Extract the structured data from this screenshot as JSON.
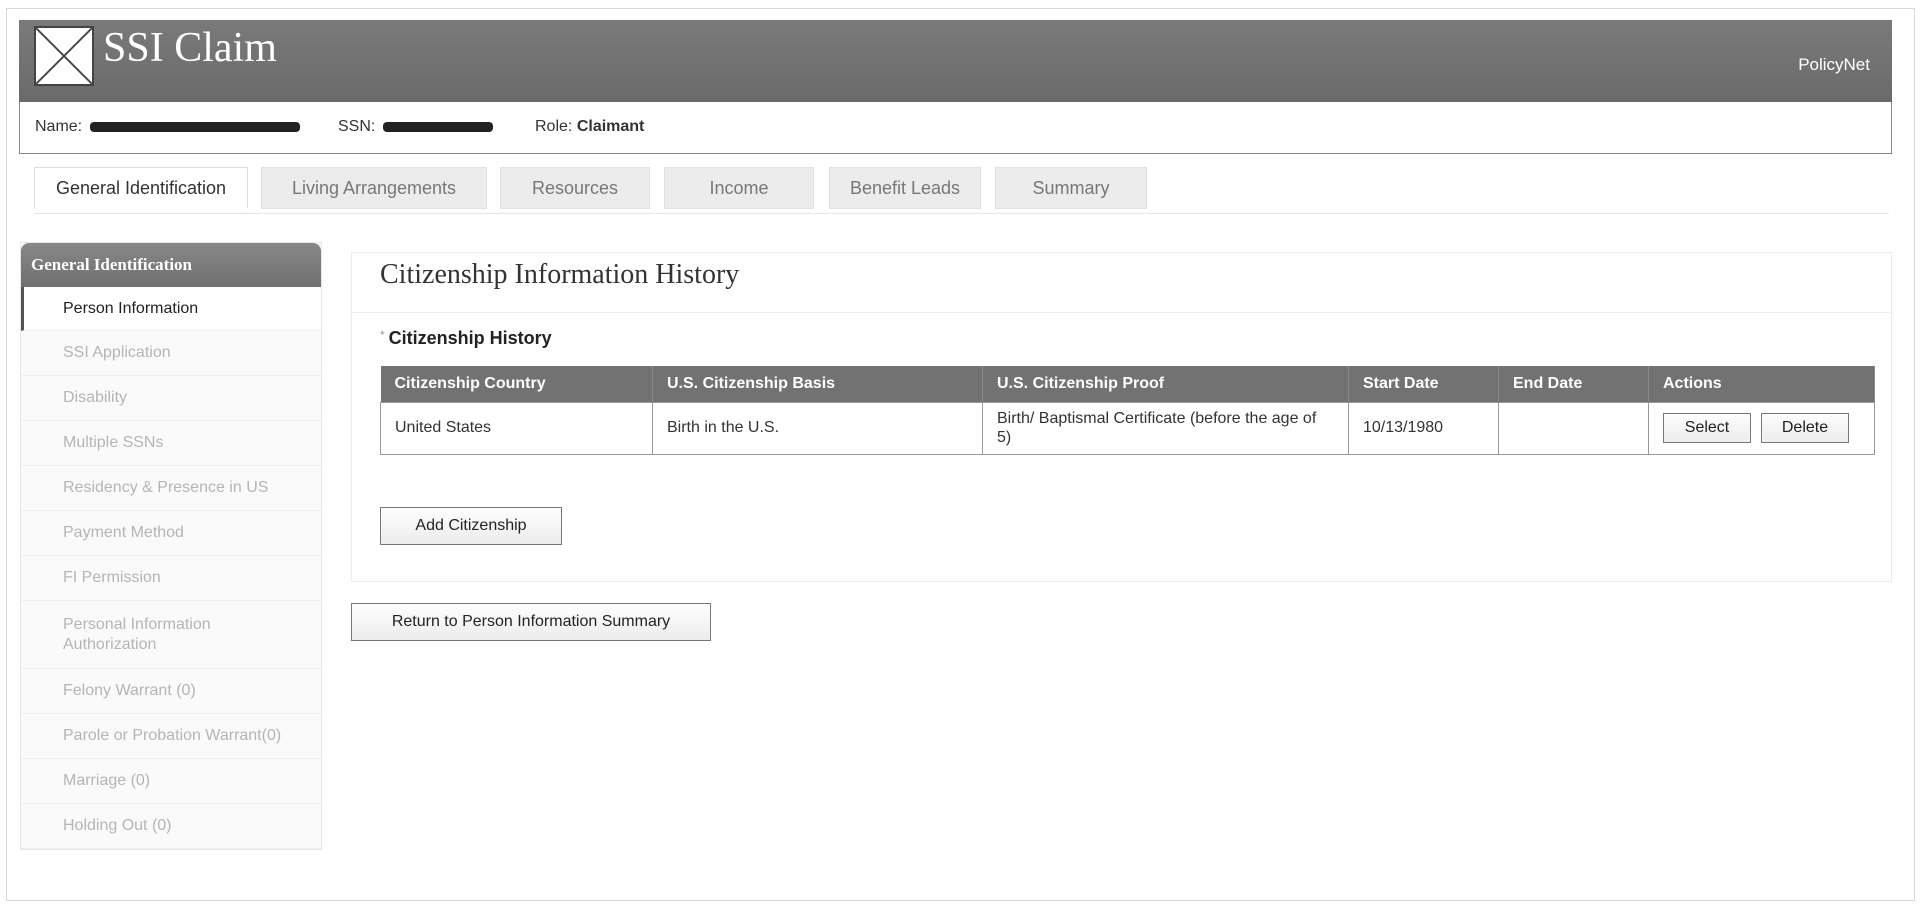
{
  "header": {
    "app_title": "SSI Claim",
    "right_link": "PolicyNet",
    "logo_icon": "image-placeholder-icon"
  },
  "info_bar": {
    "name_label": "Name:",
    "ssn_label": "SSN:",
    "role_label": "Role:",
    "role_value": "Claimant"
  },
  "tabs": [
    {
      "label": "General Identification",
      "active": true
    },
    {
      "label": "Living Arrangements",
      "active": false
    },
    {
      "label": "Resources",
      "active": false
    },
    {
      "label": "Income",
      "active": false
    },
    {
      "label": "Benefit Leads",
      "active": false
    },
    {
      "label": "Summary",
      "active": false
    }
  ],
  "sidebar": {
    "title": "General Identification",
    "items": [
      {
        "label": "Person Information",
        "active": true
      },
      {
        "label": "SSI Application",
        "active": false
      },
      {
        "label": "Disability",
        "active": false
      },
      {
        "label": "Multiple SSNs",
        "active": false
      },
      {
        "label": "Residency & Presence in US",
        "active": false
      },
      {
        "label": "Payment Method",
        "active": false
      },
      {
        "label": "FI Permission",
        "active": false
      },
      {
        "label": "Personal Information Authorization",
        "active": false
      },
      {
        "label": "Felony Warrant (0)",
        "active": false
      },
      {
        "label": "Parole or Probation Warrant(0)",
        "active": false
      },
      {
        "label": "Marriage (0)",
        "active": false
      },
      {
        "label": "Holding Out (0)",
        "active": false
      }
    ]
  },
  "main": {
    "title": "Citizenship Information History",
    "required_marker": "*",
    "section_label": "Citizenship History",
    "table": {
      "headers": [
        "Citizenship Country",
        "U.S. Citizenship Basis",
        "U.S. Citizenship Proof",
        "Start Date",
        "End Date",
        "Actions"
      ],
      "rows": [
        [
          "United States",
          "Birth in the U.S.",
          "Birth/ Baptismal Certificate (before the age of 5)",
          "10/13/1980",
          ""
        ]
      ],
      "select_label": "Select",
      "delete_label": "Delete"
    },
    "add_button": "Add Citizenship"
  },
  "footer": {
    "return_button": "Return to Person Information Summary"
  }
}
